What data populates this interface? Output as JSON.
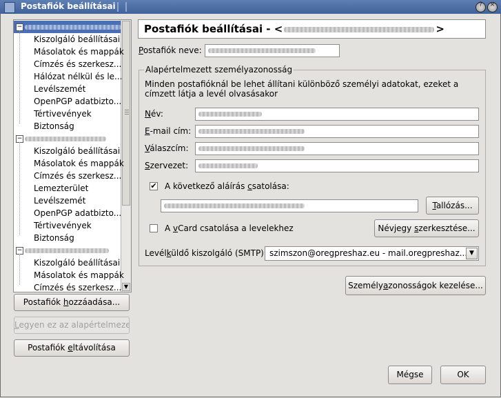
{
  "window": {
    "title": "Postafiók beállításai"
  },
  "tree": {
    "accounts": [
      {
        "items": [
          "Kiszolgáló beállításai",
          "Másolatok és mappák",
          "Címzés és szerkesz...",
          "Hálózat nélkül és le...",
          "Levélszemét",
          "OpenPGP adatbizto...",
          "Tértivevények",
          "Biztonság"
        ]
      },
      {
        "items": [
          "Kiszolgáló beállításai",
          "Másolatok és mappák",
          "Címzés és szerkesz...",
          "Lemezterület",
          "Levélszemét",
          "OpenPGP adatbizto...",
          "Tértivevények",
          "Biztonság"
        ]
      },
      {
        "items": [
          "Kiszolgáló beállításai",
          "Másolatok és mappák",
          "Címzés és szerkesz..."
        ]
      }
    ]
  },
  "left_buttons": {
    "add": {
      "pre": "Postafiók ",
      "u": "h",
      "post": "ozzáadása..."
    },
    "default": {
      "pre": "",
      "u": "L",
      "post": "egyen ez az alapértelmezett"
    },
    "remove": {
      "pre": "Postafiók ",
      "u": "e",
      "post": "ltávolítása"
    }
  },
  "header": {
    "title_pre": "Postafiók beállításai - <",
    "title_post": ">"
  },
  "account_name_label": {
    "pre": "",
    "u": "P",
    "post": "ostafiók neve:"
  },
  "identity": {
    "group_title": "Alapértelmezett személyazonosság",
    "description": "Minden postafióknál be lehet állítani különböző személyi adatokat, ezeket a címzett látja a levél olvasásakor",
    "name_label": {
      "u": "N",
      "post": "év:"
    },
    "email_label": {
      "u": "E",
      "post": "-mail cím:"
    },
    "reply_label": {
      "u": "V",
      "post": "álaszcím:"
    },
    "org_label": {
      "u": "S",
      "post": "zervezet:"
    },
    "signature_check": {
      "pre": "A következő aláírás ",
      "u": "c",
      "post": "satolása:",
      "checked": true
    },
    "browse_button": {
      "u": "T",
      "post": "allózás..."
    },
    "vcard_check": {
      "pre": "A ",
      "u": "v",
      "post": "Card csatolása a levelekhez",
      "checked": false
    },
    "vcard_button": {
      "pre": "Névjegy ",
      "u": "s",
      "post": "zerkesztése..."
    },
    "smtp_label": {
      "pre": "Levél",
      "u": "k",
      "post": "üldő kiszolgáló (SMTP):"
    },
    "smtp_value": "szimszon@oregpreshaz.eu - mail.oregpreshaz...."
  },
  "manage_identities": {
    "pre": "Személy",
    "u": "a",
    "post": "zonosságok kezelése..."
  },
  "dialog_buttons": {
    "cancel": "Mégse",
    "ok": "OK"
  },
  "icons": {
    "checkmark": "✔",
    "expander": "−",
    "dropdown": "▼",
    "scroll_down": "▼"
  }
}
